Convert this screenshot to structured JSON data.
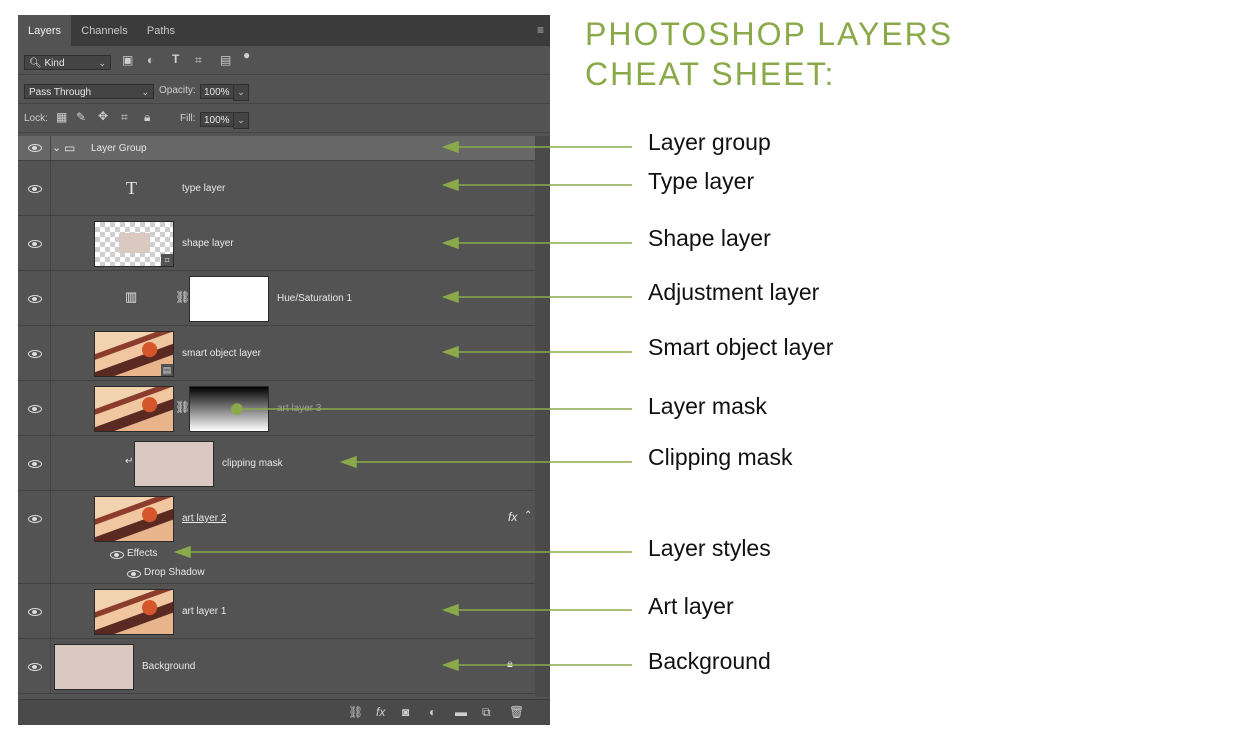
{
  "panel": {
    "tabs": [
      {
        "label": "Layers"
      },
      {
        "label": "Channels"
      },
      {
        "label": "Paths"
      }
    ],
    "filter": {
      "label": "Kind"
    },
    "blend_mode": "Pass Through",
    "opacity_label": "Opacity:",
    "opacity_value": "100%",
    "lock_label": "Lock:",
    "fill_label": "Fill:",
    "fill_value": "100%",
    "layers": [
      {
        "name": "Layer Group"
      },
      {
        "name": "type layer"
      },
      {
        "name": "shape layer"
      },
      {
        "name": "Hue/Saturation 1"
      },
      {
        "name": "smart object layer"
      },
      {
        "name": "art layer 3"
      },
      {
        "name": "clipping mask"
      },
      {
        "name": "art layer 2"
      },
      {
        "name": "art layer 1"
      },
      {
        "name": "Background"
      }
    ],
    "effects_label": "Effects",
    "drop_shadow_label": "Drop Shadow",
    "fx_label": "fx"
  },
  "cheat_sheet": {
    "title_line1": "PHOTOSHOP LAYERS",
    "title_line2": "CHEAT SHEET:",
    "labels": [
      {
        "text": "Layer group"
      },
      {
        "text": "Type layer"
      },
      {
        "text": "Shape layer"
      },
      {
        "text": "Adjustment layer"
      },
      {
        "text": "Smart object layer"
      },
      {
        "text": "Layer mask"
      },
      {
        "text": "Clipping mask"
      },
      {
        "text": "Layer styles"
      },
      {
        "text": "Art layer"
      },
      {
        "text": "Background"
      }
    ]
  },
  "colors": {
    "accent": "#8aaa4a",
    "panel_bg": "#535353",
    "group_bg": "#676767"
  }
}
